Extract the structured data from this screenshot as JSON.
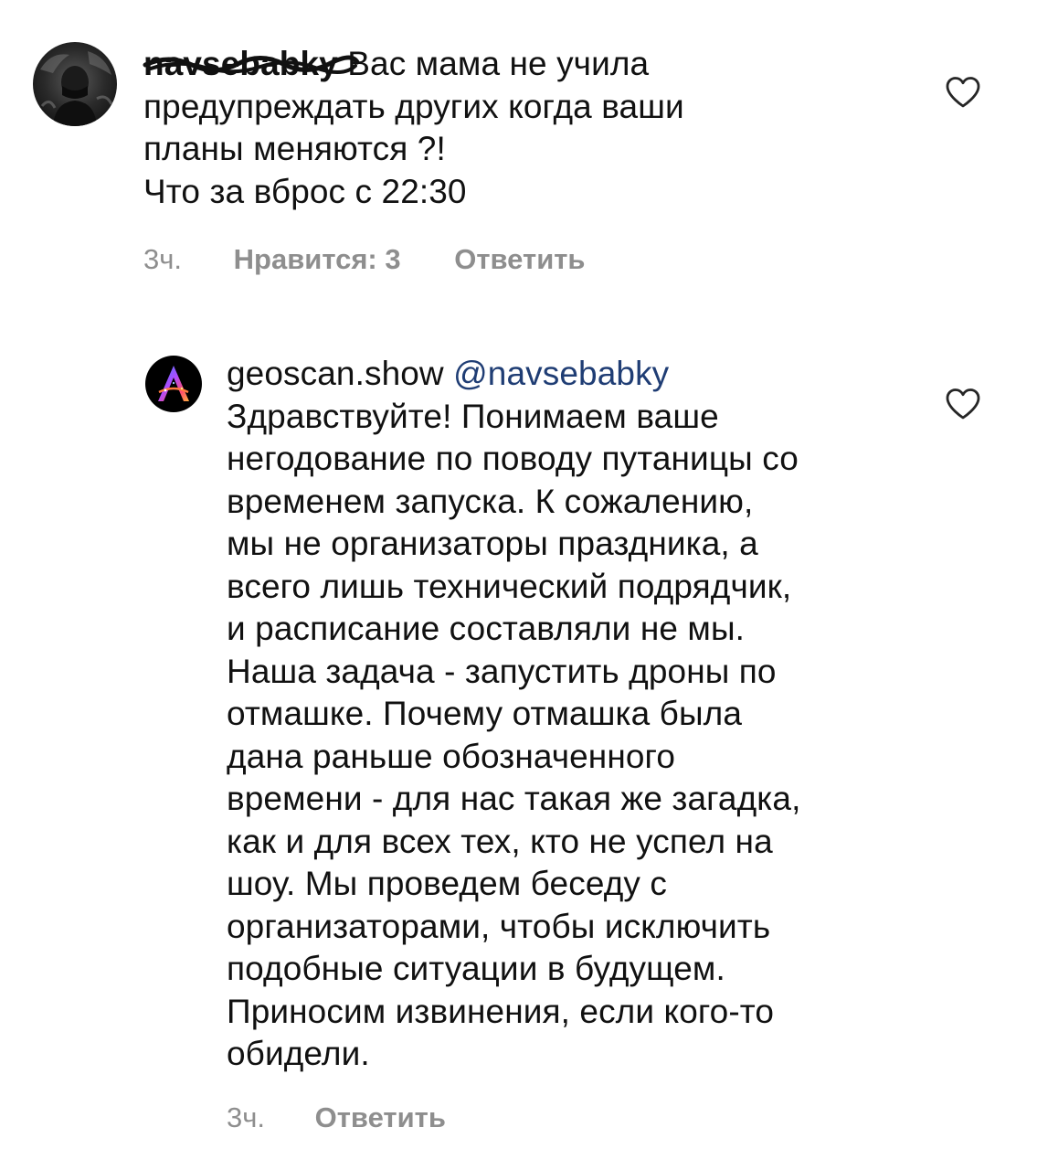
{
  "comments": [
    {
      "username": "navsebabky",
      "text_lines": [
        "Вас мама не учила",
        "предупреждать других когда ваши",
        "планы меняются ?!",
        "Что за вброс с 22:30"
      ],
      "time": "3ч.",
      "likes_label": "Нравится: 3",
      "reply_label": "Ответить",
      "like_icon": "heart-outline-icon"
    },
    {
      "username": "geoscan.show",
      "mention": "@navsebabky",
      "text_lines": [
        "Здравствуйте! Понимаем ваше",
        "негодование по поводу путаницы со",
        "временем запуска. К сожалению,",
        "мы не организаторы праздника, а",
        "всего лишь технический подрядчик,",
        "и расписание составляли не мы.",
        "Наша задача - запустить дроны по",
        "отмашке. Почему отмашка была",
        "дана раньше обозначенного",
        "времени - для нас такая же загадка,",
        "как и для всех тех, кто не успел на",
        "шоу. Мы проведем беседу с",
        "организаторами, чтобы исключить",
        "подобные ситуации в будущем.",
        "Приносим извинения, если кого-то",
        "обидели."
      ],
      "time": "3ч.",
      "reply_label": "Ответить",
      "like_icon": "heart-outline-icon"
    }
  ],
  "colors": {
    "text": "#111111",
    "meta": "#8e8e8e",
    "mention": "#1f3d74"
  }
}
